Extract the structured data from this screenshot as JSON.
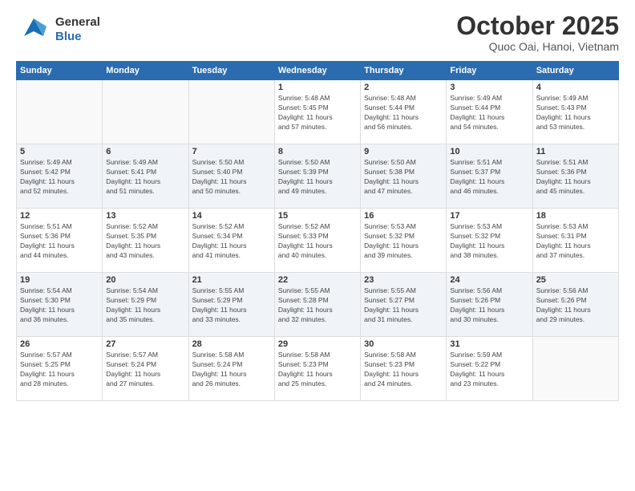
{
  "header": {
    "logo_line1": "General",
    "logo_line2": "Blue",
    "title": "October 2025",
    "subtitle": "Quoc Oai, Hanoi, Vietnam"
  },
  "days_of_week": [
    "Sunday",
    "Monday",
    "Tuesday",
    "Wednesday",
    "Thursday",
    "Friday",
    "Saturday"
  ],
  "weeks": [
    [
      {
        "day": "",
        "info": ""
      },
      {
        "day": "",
        "info": ""
      },
      {
        "day": "",
        "info": ""
      },
      {
        "day": "1",
        "info": "Sunrise: 5:48 AM\nSunset: 5:45 PM\nDaylight: 11 hours\nand 57 minutes."
      },
      {
        "day": "2",
        "info": "Sunrise: 5:48 AM\nSunset: 5:44 PM\nDaylight: 11 hours\nand 56 minutes."
      },
      {
        "day": "3",
        "info": "Sunrise: 5:49 AM\nSunset: 5:44 PM\nDaylight: 11 hours\nand 54 minutes."
      },
      {
        "day": "4",
        "info": "Sunrise: 5:49 AM\nSunset: 5:43 PM\nDaylight: 11 hours\nand 53 minutes."
      }
    ],
    [
      {
        "day": "5",
        "info": "Sunrise: 5:49 AM\nSunset: 5:42 PM\nDaylight: 11 hours\nand 52 minutes."
      },
      {
        "day": "6",
        "info": "Sunrise: 5:49 AM\nSunset: 5:41 PM\nDaylight: 11 hours\nand 51 minutes."
      },
      {
        "day": "7",
        "info": "Sunrise: 5:50 AM\nSunset: 5:40 PM\nDaylight: 11 hours\nand 50 minutes."
      },
      {
        "day": "8",
        "info": "Sunrise: 5:50 AM\nSunset: 5:39 PM\nDaylight: 11 hours\nand 49 minutes."
      },
      {
        "day": "9",
        "info": "Sunrise: 5:50 AM\nSunset: 5:38 PM\nDaylight: 11 hours\nand 47 minutes."
      },
      {
        "day": "10",
        "info": "Sunrise: 5:51 AM\nSunset: 5:37 PM\nDaylight: 11 hours\nand 46 minutes."
      },
      {
        "day": "11",
        "info": "Sunrise: 5:51 AM\nSunset: 5:36 PM\nDaylight: 11 hours\nand 45 minutes."
      }
    ],
    [
      {
        "day": "12",
        "info": "Sunrise: 5:51 AM\nSunset: 5:36 PM\nDaylight: 11 hours\nand 44 minutes."
      },
      {
        "day": "13",
        "info": "Sunrise: 5:52 AM\nSunset: 5:35 PM\nDaylight: 11 hours\nand 43 minutes."
      },
      {
        "day": "14",
        "info": "Sunrise: 5:52 AM\nSunset: 5:34 PM\nDaylight: 11 hours\nand 41 minutes."
      },
      {
        "day": "15",
        "info": "Sunrise: 5:52 AM\nSunset: 5:33 PM\nDaylight: 11 hours\nand 40 minutes."
      },
      {
        "day": "16",
        "info": "Sunrise: 5:53 AM\nSunset: 5:32 PM\nDaylight: 11 hours\nand 39 minutes."
      },
      {
        "day": "17",
        "info": "Sunrise: 5:53 AM\nSunset: 5:32 PM\nDaylight: 11 hours\nand 38 minutes."
      },
      {
        "day": "18",
        "info": "Sunrise: 5:53 AM\nSunset: 5:31 PM\nDaylight: 11 hours\nand 37 minutes."
      }
    ],
    [
      {
        "day": "19",
        "info": "Sunrise: 5:54 AM\nSunset: 5:30 PM\nDaylight: 11 hours\nand 36 minutes."
      },
      {
        "day": "20",
        "info": "Sunrise: 5:54 AM\nSunset: 5:29 PM\nDaylight: 11 hours\nand 35 minutes."
      },
      {
        "day": "21",
        "info": "Sunrise: 5:55 AM\nSunset: 5:29 PM\nDaylight: 11 hours\nand 33 minutes."
      },
      {
        "day": "22",
        "info": "Sunrise: 5:55 AM\nSunset: 5:28 PM\nDaylight: 11 hours\nand 32 minutes."
      },
      {
        "day": "23",
        "info": "Sunrise: 5:55 AM\nSunset: 5:27 PM\nDaylight: 11 hours\nand 31 minutes."
      },
      {
        "day": "24",
        "info": "Sunrise: 5:56 AM\nSunset: 5:26 PM\nDaylight: 11 hours\nand 30 minutes."
      },
      {
        "day": "25",
        "info": "Sunrise: 5:56 AM\nSunset: 5:26 PM\nDaylight: 11 hours\nand 29 minutes."
      }
    ],
    [
      {
        "day": "26",
        "info": "Sunrise: 5:57 AM\nSunset: 5:25 PM\nDaylight: 11 hours\nand 28 minutes."
      },
      {
        "day": "27",
        "info": "Sunrise: 5:57 AM\nSunset: 5:24 PM\nDaylight: 11 hours\nand 27 minutes."
      },
      {
        "day": "28",
        "info": "Sunrise: 5:58 AM\nSunset: 5:24 PM\nDaylight: 11 hours\nand 26 minutes."
      },
      {
        "day": "29",
        "info": "Sunrise: 5:58 AM\nSunset: 5:23 PM\nDaylight: 11 hours\nand 25 minutes."
      },
      {
        "day": "30",
        "info": "Sunrise: 5:58 AM\nSunset: 5:23 PM\nDaylight: 11 hours\nand 24 minutes."
      },
      {
        "day": "31",
        "info": "Sunrise: 5:59 AM\nSunset: 5:22 PM\nDaylight: 11 hours\nand 23 minutes."
      },
      {
        "day": "",
        "info": ""
      }
    ]
  ]
}
